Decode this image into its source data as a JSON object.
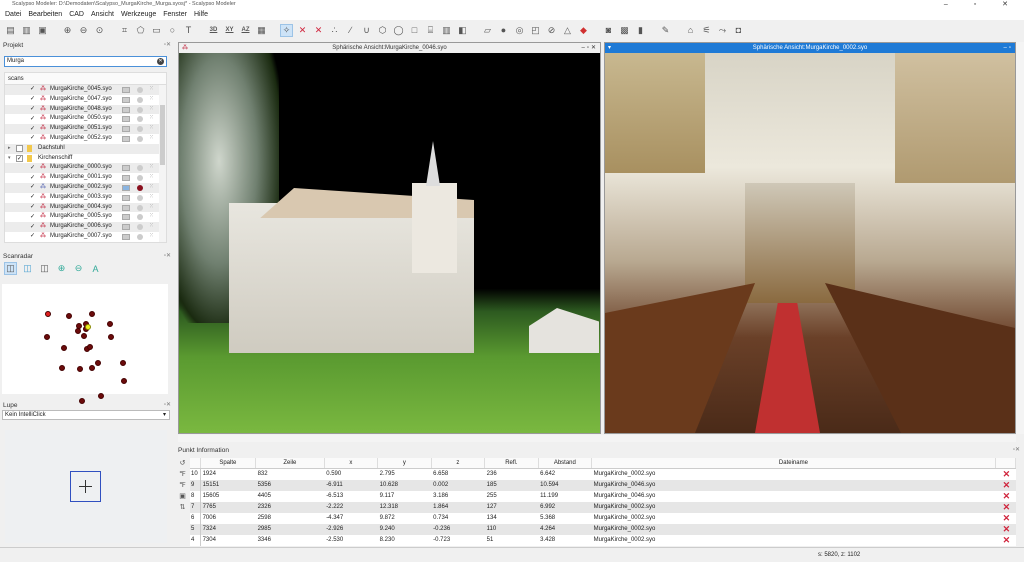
{
  "window": {
    "title": "Scalypso Modeler: D:\\Demodaten\\Scalypso_MurgaKirche_Murga.syosj* - Scalypso Modeler",
    "controls": "–  ▫  ✕"
  },
  "menu": [
    "Datei",
    "Bearbeiten",
    "CAD",
    "Ansicht",
    "Werkzeuge",
    "Fenster",
    "Hilfe"
  ],
  "toolbar": {
    "icons": [
      "open-project",
      "open-file",
      "save",
      "zoom-in",
      "zoom-out",
      "zoom-fit",
      "select-polyline",
      "select-polygon",
      "select-rect",
      "select-circle",
      "text",
      "view-3d",
      "view-xy",
      "view-az",
      "image",
      "pick-point",
      "delete-point",
      "delete-all",
      "points",
      "line",
      "polyline",
      "polygon",
      "circle",
      "rectangle",
      "grid",
      "columns",
      "layers",
      "plane",
      "sphere",
      "cylinder",
      "box",
      "pipe",
      "cone",
      "target",
      "sphere-fit",
      "checker",
      "marker",
      "measure",
      "home",
      "scan",
      "export",
      "camera"
    ]
  },
  "project": {
    "title": "Projekt",
    "search_value": "Murga",
    "column": "scans",
    "rows": [
      {
        "type": "scan",
        "name": "MurgaKirche_0045.syo",
        "checked": true
      },
      {
        "type": "scan",
        "name": "MurgaKirche_0047.syo",
        "checked": true
      },
      {
        "type": "scan",
        "name": "MurgaKirche_0048.syo",
        "checked": true
      },
      {
        "type": "scan",
        "name": "MurgaKirche_0050.syo",
        "checked": true
      },
      {
        "type": "scan",
        "name": "MurgaKirche_0051.syo",
        "checked": true
      },
      {
        "type": "scan",
        "name": "MurgaKirche_0052.syo",
        "checked": true
      },
      {
        "type": "folder",
        "name": "Dachstuhl",
        "checked": false,
        "expanded": false
      },
      {
        "type": "folder",
        "name": "Kirchenschiff",
        "checked": true,
        "expanded": true
      },
      {
        "type": "scan",
        "name": "MurgaKirche_0000.syo",
        "checked": true
      },
      {
        "type": "scan",
        "name": "MurgaKirche_0001.syo",
        "checked": true
      },
      {
        "type": "scan",
        "name": "MurgaKirche_0002.syo",
        "checked": true,
        "active": true
      },
      {
        "type": "scan",
        "name": "MurgaKirche_0003.syo",
        "checked": true
      },
      {
        "type": "scan",
        "name": "MurgaKirche_0004.syo",
        "checked": true
      },
      {
        "type": "scan",
        "name": "MurgaKirche_0005.syo",
        "checked": true
      },
      {
        "type": "scan",
        "name": "MurgaKirche_0006.syo",
        "checked": true
      },
      {
        "type": "scan",
        "name": "MurgaKirche_0007.syo",
        "checked": true
      }
    ]
  },
  "scanradar": {
    "title": "Scanradar"
  },
  "lupe": {
    "title": "Lupe",
    "mode": "Kein IntelliClick"
  },
  "views": [
    {
      "title": "Sphärische Ansicht:MurgaKirche_0046.syo",
      "active": false
    },
    {
      "title": "Sphärische Ansicht:MurgaKirche_0002.syo",
      "active": true
    }
  ],
  "punkt_info": {
    "title": "Punkt Information",
    "columns": [
      "Spalte",
      "Zeile",
      "x",
      "y",
      "z",
      "Refl.",
      "Abstand",
      "Dateiname"
    ],
    "rows": [
      {
        "id": "10",
        "spalte": "1924",
        "zeile": "832",
        "x": "0.590",
        "y": "2.795",
        "z": "6.658",
        "refl": "236",
        "abstand": "6.642",
        "datei": "MurgaKirche_0002.syo"
      },
      {
        "id": "9",
        "spalte": "15151",
        "zeile": "5356",
        "x": "-6.911",
        "y": "10.628",
        "z": "0.002",
        "refl": "185",
        "abstand": "10.594",
        "datei": "MurgaKirche_0046.syo"
      },
      {
        "id": "8",
        "spalte": "15605",
        "zeile": "4405",
        "x": "-6.513",
        "y": "9.117",
        "z": "3.186",
        "refl": "255",
        "abstand": "11.199",
        "datei": "MurgaKirche_0046.syo"
      },
      {
        "id": "7",
        "spalte": "7765",
        "zeile": "2326",
        "x": "-2.222",
        "y": "12.318",
        "z": "1.864",
        "refl": "127",
        "abstand": "6.992",
        "datei": "MurgaKirche_0002.syo"
      },
      {
        "id": "6",
        "spalte": "7006",
        "zeile": "2598",
        "x": "-4.347",
        "y": "9.872",
        "z": "0.734",
        "refl": "134",
        "abstand": "5.368",
        "datei": "MurgaKirche_0002.syo"
      },
      {
        "id": "5",
        "spalte": "7324",
        "zeile": "2985",
        "x": "-2.926",
        "y": "9.240",
        "z": "-0.236",
        "refl": "110",
        "abstand": "4.264",
        "datei": "MurgaKirche_0002.syo"
      },
      {
        "id": "4",
        "spalte": "7304",
        "zeile": "3346",
        "x": "-2.530",
        "y": "8.230",
        "z": "-0.723",
        "refl": "51",
        "abstand": "3.428",
        "datei": "MurgaKirche_0002.syo"
      }
    ]
  },
  "status": {
    "text": "s: 5820, z: 1102"
  },
  "colors": {
    "accent": "#1e7ad6",
    "scan_icon": "#c0203a",
    "delete": "#d0243c",
    "radar_dot": "#6b0b0b",
    "radar_active": "#f0f020",
    "radar_selected": "#e02020"
  }
}
